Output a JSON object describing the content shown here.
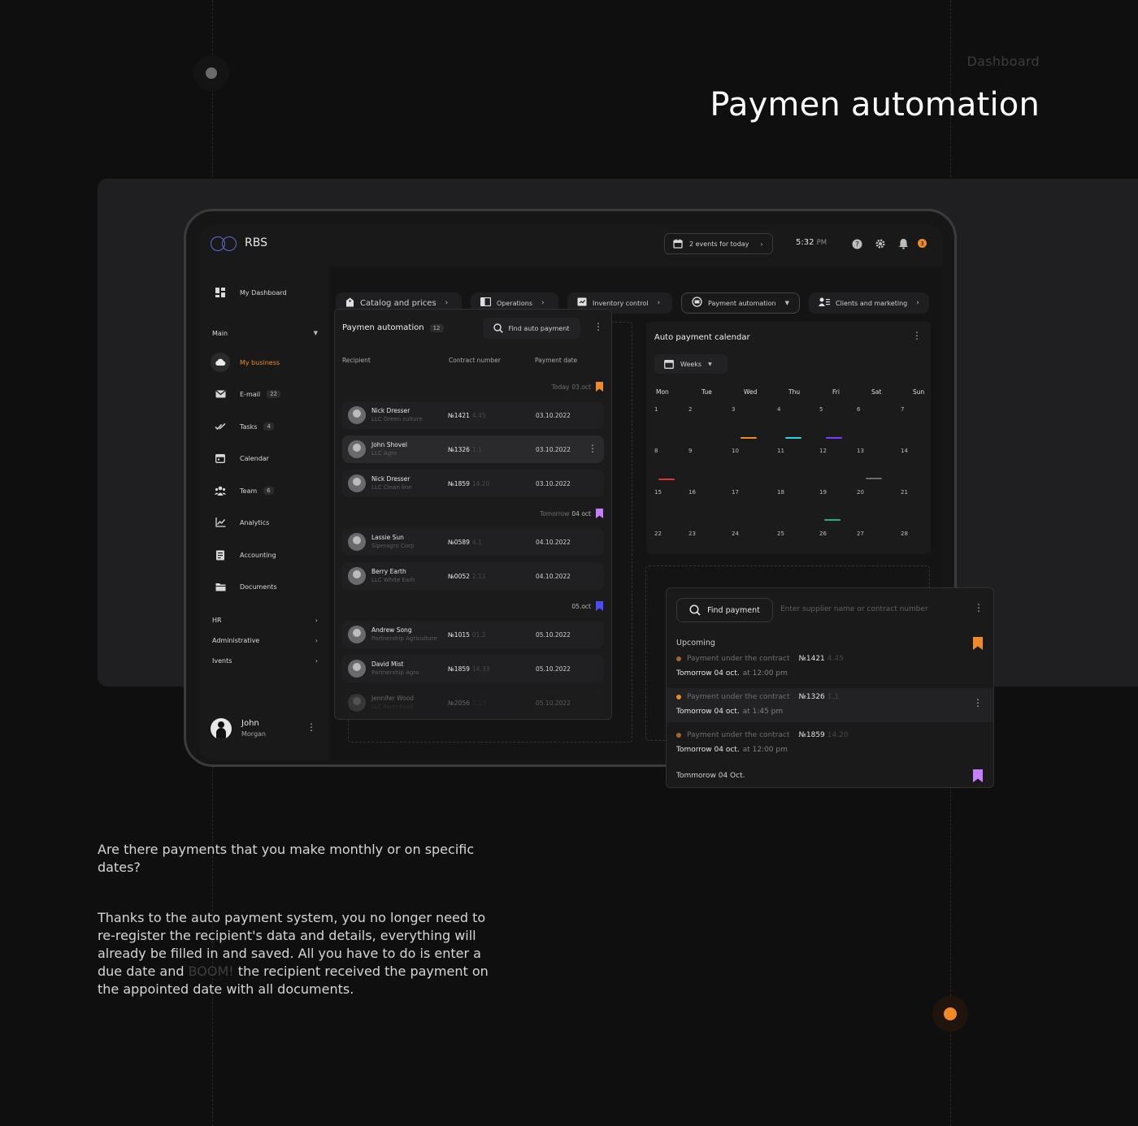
{
  "header": {
    "eyebrow": "Dashboard",
    "title": "Paymen automation"
  },
  "app": {
    "logo": "RBS",
    "events": "2 events for today",
    "time": "5:32",
    "ampm": "PM",
    "notifications": "3",
    "sidebar": {
      "dashboard": "My Dashboard",
      "main": "Main",
      "items": [
        {
          "label": "My business",
          "icon": "cloud-icon",
          "active": true
        },
        {
          "label": "E-mail",
          "count": "22",
          "icon": "mail-icon"
        },
        {
          "label": "Tasks",
          "count": "4",
          "icon": "check-icon"
        },
        {
          "label": "Calendar",
          "icon": "calendar-icon"
        },
        {
          "label": "Team",
          "count": "6",
          "icon": "team-icon"
        },
        {
          "label": "Analytics",
          "icon": "chart-icon"
        },
        {
          "label": "Accounting",
          "icon": "ledger-icon"
        },
        {
          "label": "Documents",
          "icon": "folder-icon"
        }
      ],
      "sections": [
        "HR",
        "Administrative",
        "Ivents"
      ],
      "user": {
        "first": "John",
        "last": "Morgan"
      }
    },
    "nav": [
      {
        "label": "Catalog and prices"
      },
      {
        "label": "Operations"
      },
      {
        "label": "Inventory control"
      },
      {
        "label": "Payment automation"
      },
      {
        "label": "Clients and marketing"
      }
    ],
    "list": {
      "title": "Paymen automation",
      "count": "12",
      "search": "Find auto payment",
      "columns": {
        "recipient": "Recipient",
        "contract": "Contract number",
        "date": "Payment date"
      },
      "groups": [
        {
          "prefix": "Today",
          "day": "03.oct",
          "color": "#f08a24"
        },
        {
          "prefix": "Tomorrow",
          "day": "04 oct",
          "color": "#c77dff"
        },
        {
          "prefix": "",
          "day": "05.oct",
          "color": "#4b4bff"
        }
      ],
      "rows": [
        {
          "name": "Nick Dresser",
          "company": "LLC Green culture",
          "contract": "№1421",
          "sub": "4.45",
          "date": "03.10.2022"
        },
        {
          "name": "John Shovel",
          "company": "LLC Agro",
          "contract": "№1326",
          "sub": "1.1",
          "date": "03.10.2022"
        },
        {
          "name": "Nick Dresser",
          "company": "LLC Clean line",
          "contract": "№1859",
          "sub": "14.20",
          "date": "03.10.2022"
        },
        {
          "name": "Lassie Sun",
          "company": "Siperagro Corp",
          "contract": "№0589",
          "sub": "4.1",
          "date": "04.10.2022"
        },
        {
          "name": "Berry Earth",
          "company": "LLC White Earh",
          "contract": "№0052",
          "sub": "2.11",
          "date": "04.10.2022"
        },
        {
          "name": "Andrew Song",
          "company": "Partnership Agriculture",
          "contract": "№1015",
          "sub": "01.2",
          "date": "05.10.2022"
        },
        {
          "name": "David Mist",
          "company": "Partnership Agro",
          "contract": "№1859",
          "sub": "14.33",
          "date": "05.10.2022"
        },
        {
          "name": "Jennifer Wood",
          "company": "LLC Farm Food",
          "contract": "№2056",
          "sub": "2.13",
          "date": "05.10.2022"
        }
      ]
    },
    "calendar": {
      "title": "Auto payment calendar",
      "view": "Weeks",
      "days": [
        "Mon",
        "Tue",
        "Wed",
        "Thu",
        "Fri",
        "Sat",
        "Sun"
      ],
      "weeks": [
        [
          "1",
          "2",
          "3",
          "4",
          "5",
          "6",
          "7"
        ],
        [
          "8",
          "9",
          "10",
          "11",
          "12",
          "13",
          "14"
        ],
        [
          "15",
          "16",
          "17",
          "18",
          "19",
          "20",
          "21"
        ],
        [
          "22",
          "23",
          "24",
          "25",
          "26",
          "27",
          "28"
        ]
      ],
      "events": [
        {
          "color": "#f08a24"
        },
        {
          "color": "#2fd3e0"
        },
        {
          "color": "#7d3cff"
        },
        {
          "color": "#e0322f"
        },
        {
          "color": "#6b6b6d"
        },
        {
          "color": "#1fb08a"
        }
      ]
    },
    "finder": {
      "button": "Find payment",
      "placeholder": "Enter supplier name or contract number",
      "upcoming": "Upcoming",
      "items": [
        {
          "text": "Payment under the contract",
          "num": "№1421",
          "sub": "4.45",
          "when": "Tomorrow 04 oct.",
          "at": "at 12:00 pm",
          "dot": "#a0662a"
        },
        {
          "text": "Payment under the contract",
          "num": "№1326",
          "sub": "1.1",
          "when": "Tomorrow 04 oct.",
          "at": "at 1:45 pm",
          "dot": "#f08a24"
        },
        {
          "text": "Payment under the contract",
          "num": "№1859",
          "sub": "14.20",
          "when": "Tomorrow 04 oct.",
          "at": "at 12:00 pm",
          "dot": "#a0662a"
        }
      ],
      "footer": "Tommorow 04 Oct."
    }
  },
  "copy": {
    "question": "Are there payments that you make monthly or on specific dates?",
    "p1": "Thanks to the auto payment system, you no longer need to re-register the recipient's data and details, everything will already be filled in and saved. All you have to do is enter a due date and",
    "boom": "BOOM!",
    "p2": "the recipient received the payment on the appointed date with all documents."
  }
}
